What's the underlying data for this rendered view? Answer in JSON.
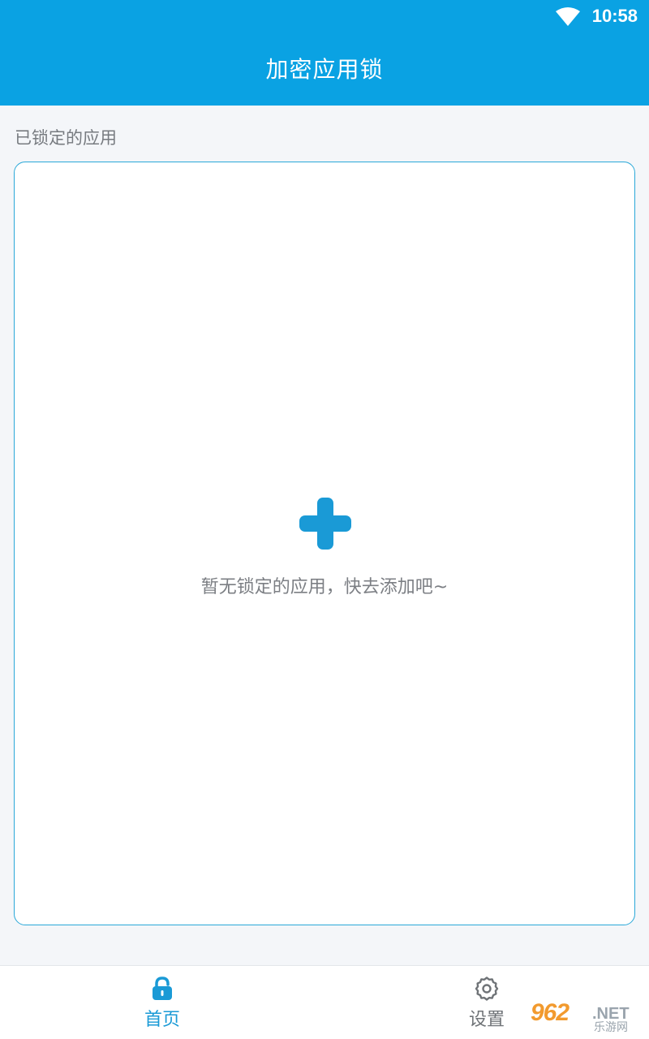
{
  "status_bar": {
    "time": "10:58",
    "wifi_icon": "wifi-icon"
  },
  "app_bar": {
    "title": "加密应用锁"
  },
  "main": {
    "section_label": "已锁定的应用",
    "empty_state": {
      "add_icon": "plus-icon",
      "message": "暂无锁定的应用，快去添加吧~"
    }
  },
  "bottom_nav": {
    "items": [
      {
        "label": "首页",
        "icon": "lock-icon",
        "active": true
      },
      {
        "label": "设置",
        "icon": "gear-icon",
        "active": false
      }
    ]
  },
  "watermark": {
    "main": "962",
    "suffix": ".NET",
    "sub": "乐游网"
  },
  "colors": {
    "primary": "#0aa2e3",
    "accent": "#1a9ad6",
    "background": "#f4f6f9",
    "text_muted": "#7c7f84",
    "watermark_orange": "#f29a2e"
  }
}
